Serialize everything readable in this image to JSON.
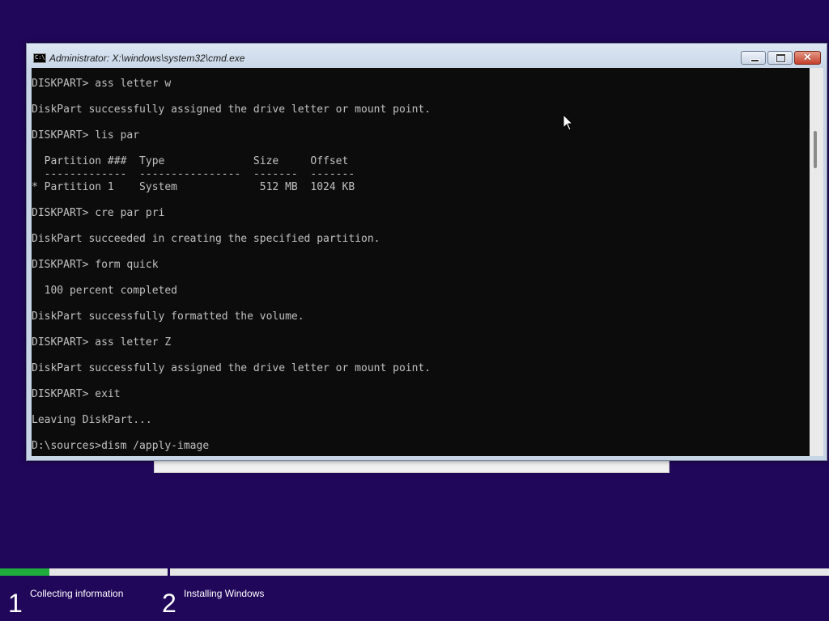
{
  "cmd": {
    "title": "Administrator: X:\\windows\\system32\\cmd.exe",
    "icon_text": "C:\\",
    "lines": [
      "DISKPART> ass letter w",
      "",
      "DiskPart successfully assigned the drive letter or mount point.",
      "",
      "DISKPART> lis par",
      "",
      "  Partition ###  Type              Size     Offset",
      "  -------------  ----------------  -------  -------",
      "* Partition 1    System             512 MB  1024 KB",
      "",
      "DISKPART> cre par pri",
      "",
      "DiskPart succeeded in creating the specified partition.",
      "",
      "DISKPART> form quick",
      "",
      "  100 percent completed",
      "",
      "DiskPart successfully formatted the volume.",
      "",
      "DISKPART> ass letter Z",
      "",
      "DiskPart successfully assigned the drive letter or mount point.",
      "",
      "DISKPART> exit",
      "",
      "Leaving DiskPart...",
      "",
      "D:\\sources>dism /apply-image"
    ],
    "close_glyph": "✕"
  },
  "steps": [
    {
      "number": "1",
      "label": "Collecting information"
    },
    {
      "number": "2",
      "label": "Installing Windows"
    }
  ],
  "progress": {
    "fraction": 0.06,
    "color": "#1fae3e"
  },
  "colors": {
    "background": "#21075a",
    "console_bg": "#0c0c0c",
    "console_text": "#c0c0c0"
  }
}
